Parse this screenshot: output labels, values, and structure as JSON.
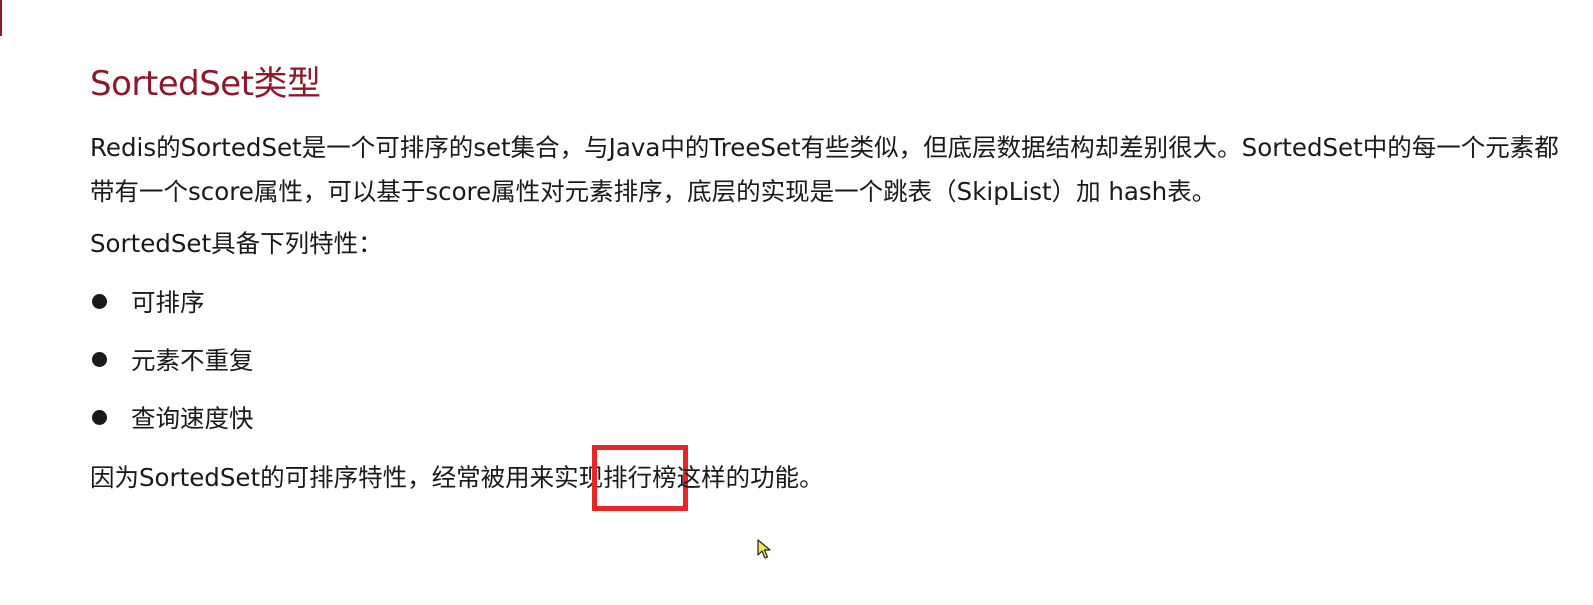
{
  "slide": {
    "title": "SortedSet类型",
    "paragraph": "Redis的SortedSet是一个可排序的set集合，与Java中的TreeSet有些类似，但底层数据结构却差别很大。SortedSet中的每一个元素都带有一个score属性，可以基于score属性对元素排序，底层的实现是一个跳表（SkipList）加 hash表。",
    "features_lead": "SortedSet具备下列特性：",
    "features": [
      "可排序",
      "元素不重复",
      "查询速度快"
    ],
    "conclusion_before": "因为SortedSet的可排序特性，经常被用来实现",
    "conclusion_highlight": "排行榜",
    "conclusion_after": "这样的功能。"
  },
  "colors": {
    "title": "#8b1a2b",
    "highlight_box": "#e8262a",
    "cursor": "#f5e94a"
  },
  "icons": {
    "bullet": "filled-circle",
    "cursor": "arrow-pointer-icon"
  }
}
